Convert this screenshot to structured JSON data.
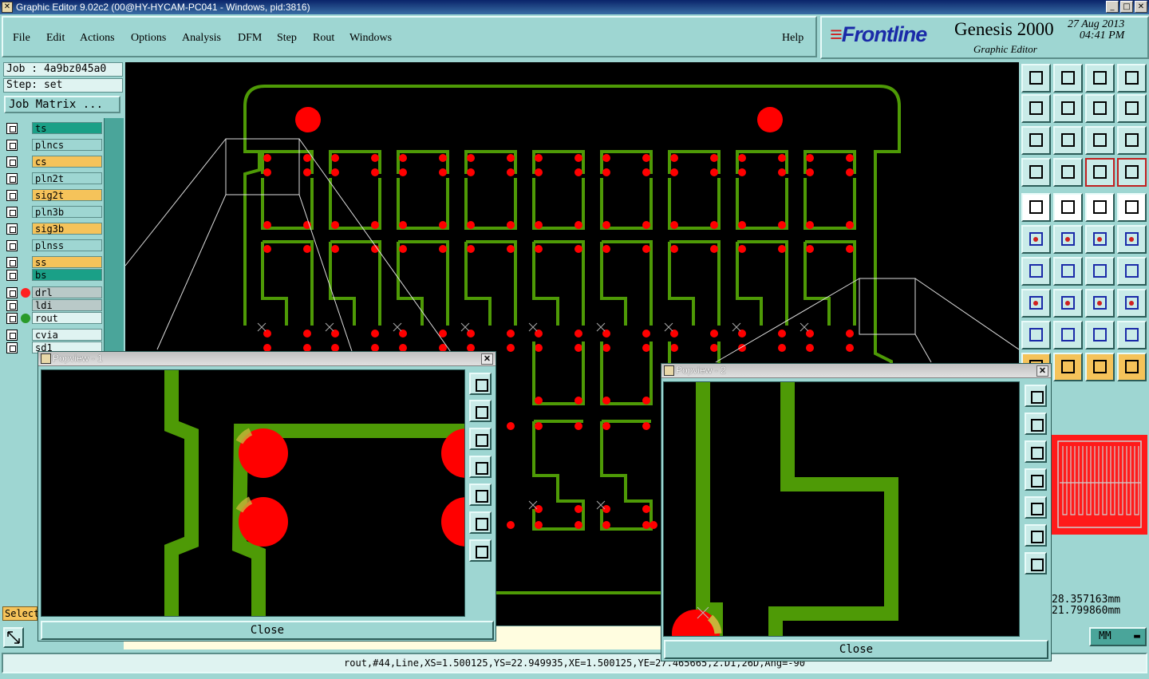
{
  "window": {
    "title": "Graphic Editor 9.02c2 (00@HY-HYCAM-PC041 - Windows, pid:3816)"
  },
  "menu": {
    "items": [
      "File",
      "Edit",
      "Actions",
      "Options",
      "Analysis",
      "DFM",
      "Step",
      "Rout",
      "Windows"
    ],
    "help": "Help"
  },
  "brand": {
    "logo": "Frontline",
    "product": "Genesis 2000",
    "subtitle": "Graphic Editor",
    "date": "27 Aug 2013",
    "time": "04:41 PM"
  },
  "job": {
    "job_label": "Job : 4a9bz045a0",
    "step_label": "Step: set",
    "job_matrix_button": "Job Matrix ..."
  },
  "layers": [
    {
      "name": "ts",
      "color": "#1aa087"
    },
    {
      "name": "plncs",
      "color": "#9ed6d2"
    },
    {
      "name": "cs",
      "color": "#f5c35a"
    },
    {
      "name": "pln2t",
      "color": "#9ed6d2"
    },
    {
      "name": "sig2t",
      "color": "#f5c35a"
    },
    {
      "name": "pln3b",
      "color": "#9ed6d2"
    },
    {
      "name": "sig3b",
      "color": "#f5c35a"
    },
    {
      "name": "plnss",
      "color": "#9ed6d2"
    },
    {
      "name": "ss",
      "color": "#f5c35a"
    },
    {
      "name": "bs",
      "color": "#1aa087"
    },
    {
      "name": "drl",
      "color": "#b9c9c8"
    },
    {
      "name": "ldi",
      "color": "#b9c9c8"
    },
    {
      "name": "rout",
      "color": "#dff3f1"
    },
    {
      "name": "cvia",
      "color": "#dff3f1"
    },
    {
      "name": "sd1",
      "color": "#dff3f1"
    }
  ],
  "popview1": {
    "title": "Popview - 1",
    "close_label": "Close"
  },
  "popview2": {
    "title": "Popview - 2",
    "close_label": "Close"
  },
  "coords": {
    "x": "28.357163mm",
    "y": "21.799860mm"
  },
  "units": "MM",
  "select_label": "Select",
  "status": "rout,#44,Line,XS=1.500125,YS=22.949935,XE=1.500125,YE=27.465665,2.D1,26D,Ang=-90"
}
